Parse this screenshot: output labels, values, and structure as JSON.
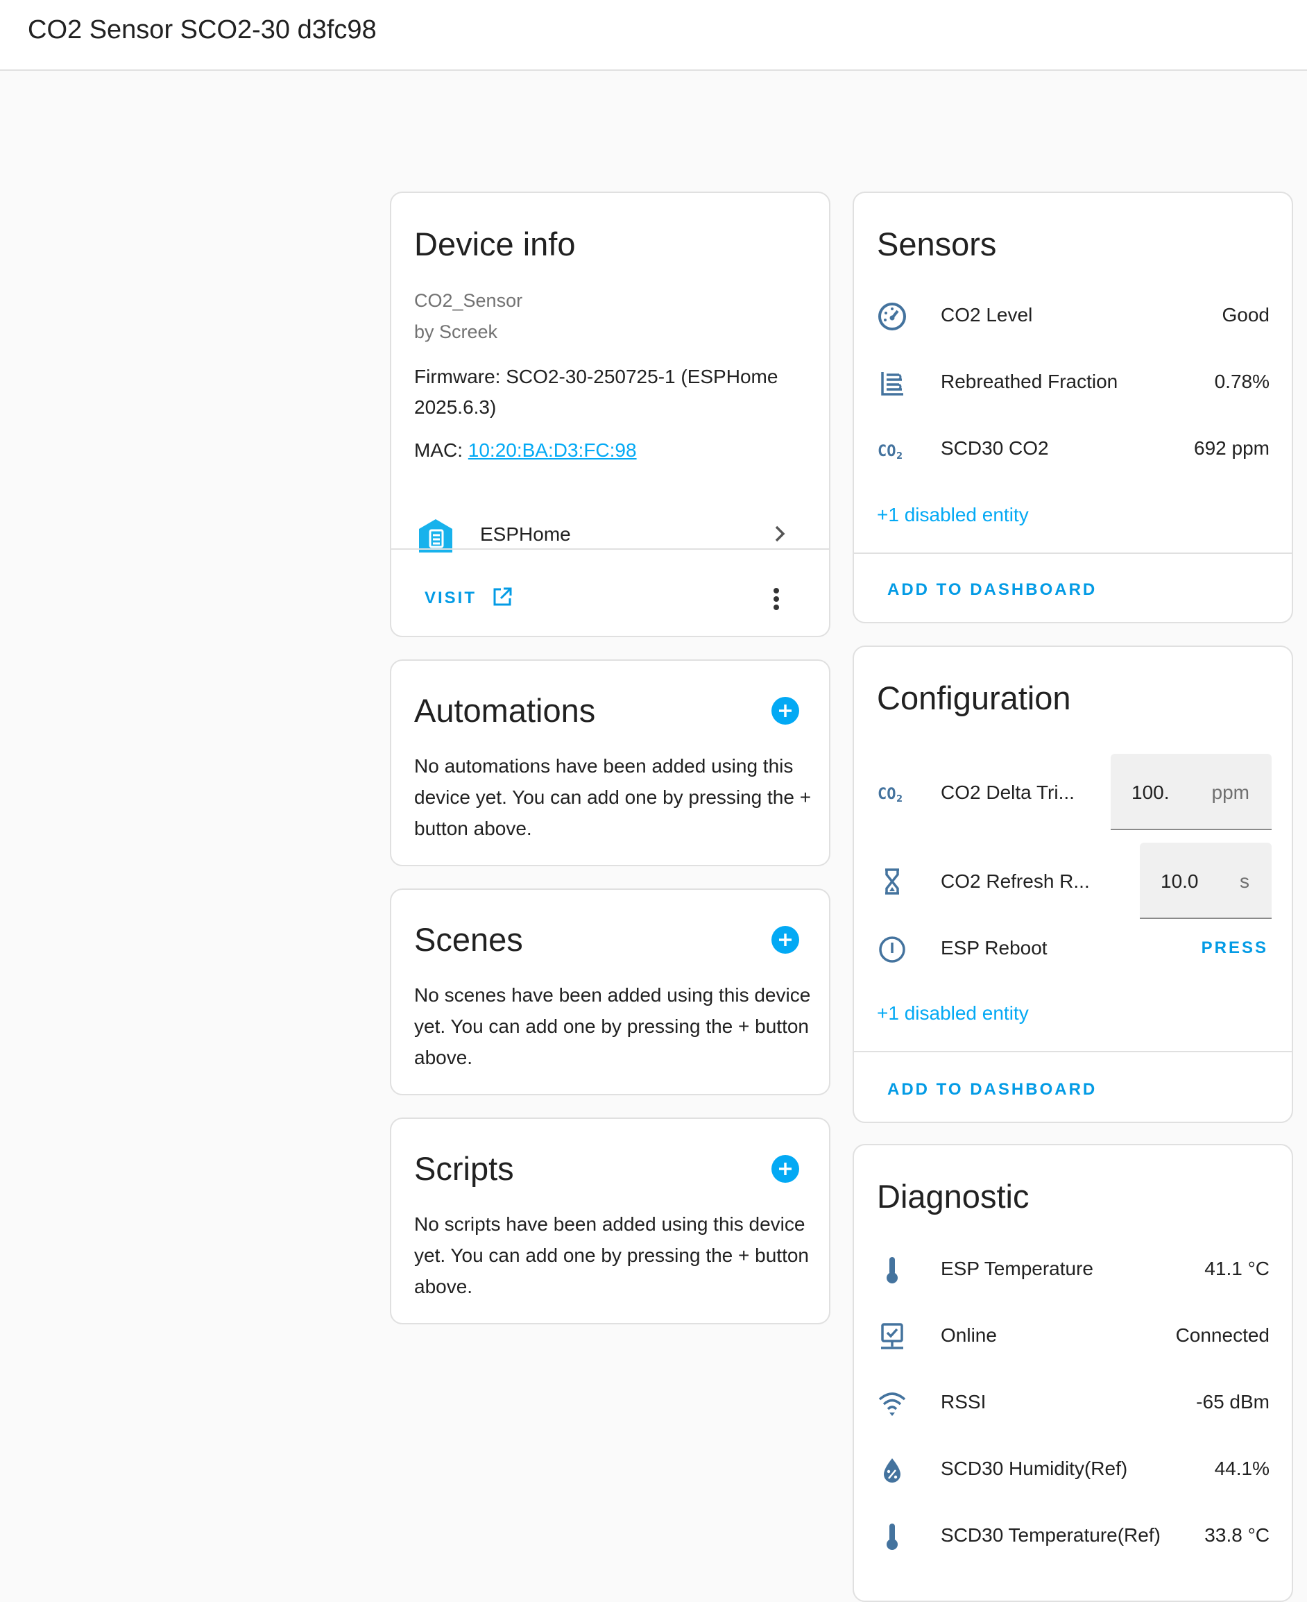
{
  "header": {
    "title": "CO2 Sensor SCO2-30 d3fc98"
  },
  "device_info": {
    "title": "Device info",
    "model": "CO2_Sensor",
    "manufacturer": "by Screek",
    "firmware_line1": "Firmware: SCO2-30-250725-1 (ESPHome",
    "firmware_line2": "2025.6.3)",
    "mac_label": "MAC:",
    "mac_value": "10:20:BA:D3:FC:98",
    "integration": "ESPHome",
    "visit_label": "VISIT"
  },
  "automations": {
    "title": "Automations",
    "line1": "No automations have been added using this",
    "line2": "device yet. You can add one by pressing the +",
    "line3": "button above."
  },
  "scenes": {
    "title": "Scenes",
    "line1": "No scenes have been added using this device",
    "line2": "yet. You can add one by pressing the + button",
    "line3": "above."
  },
  "scripts": {
    "title": "Scripts",
    "line1": "No scripts have been added using this device",
    "line2": "yet. You can add one by pressing the + button",
    "line3": "above."
  },
  "sensors": {
    "title": "Sensors",
    "items": [
      {
        "name": "CO2 Level",
        "value": "Good",
        "icon": "gauge-icon"
      },
      {
        "name": "Rebreathed Fraction",
        "value": "0.78%",
        "icon": "lungs-icon"
      },
      {
        "name": "SCD30 CO2",
        "value": "692 ppm",
        "icon": "co2-icon"
      }
    ],
    "disabled": "+1 disabled entity",
    "add_label": "ADD TO DASHBOARD"
  },
  "configuration": {
    "title": "Configuration",
    "items": [
      {
        "name": "CO2 Delta Tri...",
        "value": "100.",
        "unit": "ppm",
        "icon": "co2-icon"
      },
      {
        "name": "CO2 Refresh R...",
        "value": "10.0",
        "unit": "s",
        "icon": "hourglass-icon"
      },
      {
        "name": "ESP Reboot",
        "action": "PRESS",
        "icon": "restart-icon"
      }
    ],
    "disabled": "+1 disabled entity",
    "add_label": "ADD TO DASHBOARD"
  },
  "diagnostic": {
    "title": "Diagnostic",
    "items": [
      {
        "name": "ESP Temperature",
        "value": "41.1 °C",
        "icon": "thermometer-icon"
      },
      {
        "name": "Online",
        "value": "Connected",
        "icon": "monitor-check-icon"
      },
      {
        "name": "RSSI",
        "value": "-65 dBm",
        "icon": "wifi-icon"
      },
      {
        "name": "SCD30 Humidity(Ref)",
        "value": "44.1%",
        "icon": "water-percent-icon"
      },
      {
        "name": "SCD30 Temperature(Ref)",
        "value": "33.8 °C",
        "icon": "thermometer-icon"
      }
    ]
  },
  "colors": {
    "accent": "#03a9f4",
    "icon": "#44739e",
    "card_border": "#e0e0e0",
    "background": "#fafafa"
  }
}
